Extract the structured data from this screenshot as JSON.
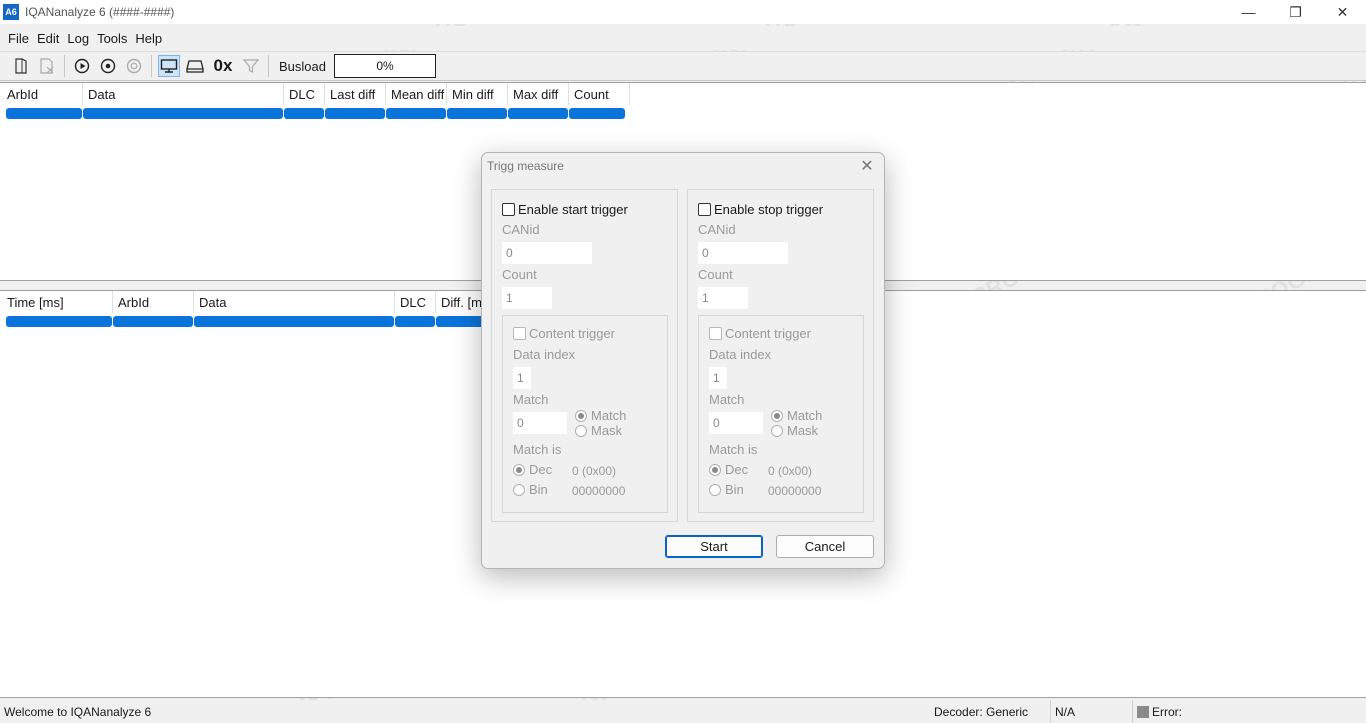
{
  "window": {
    "icon_text": "A6",
    "title": "IQANanalyze 6 (####-####)",
    "minimize_glyph": "—",
    "restore_glyph": "❐",
    "close_glyph": "✕"
  },
  "menu": [
    "File",
    "Edit",
    "Log",
    "Tools",
    "Help"
  ],
  "toolbar": {
    "hex_label": "0x",
    "busload_label": "Busload",
    "busload_value": "0%",
    "icons": [
      "file-icon",
      "save-icon",
      "play-icon",
      "record-icon",
      "stop-icon",
      "monitor-icon",
      "drive-icon",
      "hex-icon",
      "filter-icon"
    ]
  },
  "top_table": {
    "columns": [
      "ArbId",
      "Data",
      "DLC",
      "Last diff",
      "Mean diff",
      "Min diff",
      "Max diff",
      "Count"
    ]
  },
  "bottom_table": {
    "columns": [
      "Time [ms]",
      "ArbId",
      "Data",
      "DLC",
      "Diff. [ms]"
    ]
  },
  "dialog": {
    "title": "Trigg measure",
    "close_glyph": "✕",
    "start": {
      "enable_label": "Enable start trigger",
      "canid_label": "CANid",
      "canid_value": "0",
      "count_label": "Count",
      "count_value": "1",
      "content_trigger_label": "Content trigger",
      "data_index_label": "Data index",
      "data_index_value": "1",
      "match_label": "Match",
      "match_value": "0",
      "match_radio": "Match",
      "mask_radio": "Mask",
      "match_is_label": "Match is",
      "dec_label": "Dec",
      "dec_value": "0 (0x00)",
      "bin_label": "Bin",
      "bin_value": "00000000"
    },
    "stop": {
      "enable_label": "Enable stop trigger",
      "canid_label": "CANid",
      "canid_value": "0",
      "count_label": "Count",
      "count_value": "1",
      "content_trigger_label": "Content trigger",
      "data_index_label": "Data index",
      "data_index_value": "1",
      "match_label": "Match",
      "match_value": "0",
      "match_radio": "Match",
      "mask_radio": "Mask",
      "match_is_label": "Match is",
      "dec_label": "Dec",
      "dec_value": "0 (0x00)",
      "bin_label": "Bin",
      "bin_value": "00000000"
    },
    "start_button": "Start",
    "cancel_button": "Cancel"
  },
  "statusbar": {
    "welcome": "Welcome to IQANanalyze 6",
    "decoder": "Decoder: Generic",
    "na": "N/A",
    "error": "Error:"
  },
  "watermark": "MEGAPROGRAMS",
  "colors": {
    "accent": "#0a74da",
    "primary_button_border": "#0a64c8"
  }
}
